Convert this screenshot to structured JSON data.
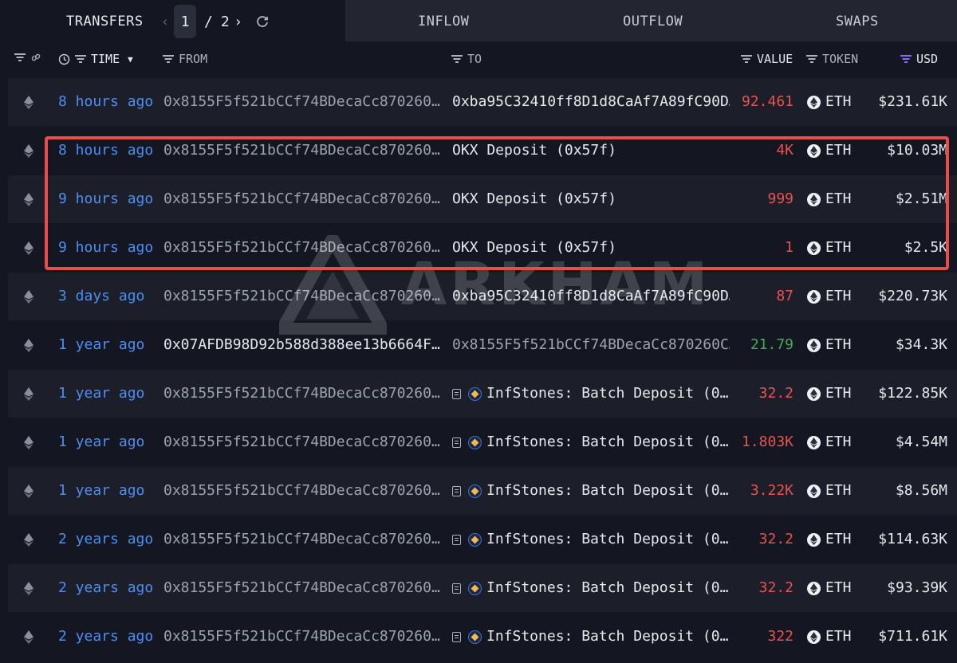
{
  "tabs": {
    "transfers": "TRANSFERS",
    "inflow": "INFLOW",
    "outflow": "OUTFLOW",
    "swaps": "SWAPS"
  },
  "pager": {
    "current": "1",
    "separator": "/",
    "total": "2"
  },
  "columns": {
    "time": "TIME",
    "from": "FROM",
    "to": "TO",
    "value": "VALUE",
    "token": "TOKEN",
    "usd": "USD"
  },
  "watermark": "ARKHAM",
  "colors": {
    "background": "#141721",
    "time_link": "#4d8ef0",
    "value_out": "#e8524f",
    "value_in": "#3fae5a",
    "highlight": "#ea4c4c",
    "usd_filter_active": "#8b6cff"
  },
  "rows": [
    {
      "time": "8 hours ago",
      "from": "0x8155F5f521bCCf74BDecaCc870260C…",
      "to": "0xba95C32410ff8D1d8CaAf7A89fC90D…",
      "value": "92.461",
      "token": "ETH",
      "usd": "$231.61K"
    },
    {
      "time": "8 hours ago",
      "from": "0x8155F5f521bCCf74BDecaCc870260C…",
      "to": "OKX Deposit (0x57f)",
      "value": "4K",
      "token": "ETH",
      "usd": "$10.03M"
    },
    {
      "time": "9 hours ago",
      "from": "0x8155F5f521bCCf74BDecaCc870260C…",
      "to": "OKX Deposit (0x57f)",
      "value": "999",
      "token": "ETH",
      "usd": "$2.51M"
    },
    {
      "time": "9 hours ago",
      "from": "0x8155F5f521bCCf74BDecaCc870260C…",
      "to": "OKX Deposit (0x57f)",
      "value": "1",
      "token": "ETH",
      "usd": "$2.5K"
    },
    {
      "time": "3 days ago",
      "from": "0x8155F5f521bCCf74BDecaCc870260C…",
      "to": "0xba95C32410ff8D1d8CaAf7A89fC90D…",
      "value": "87",
      "token": "ETH",
      "usd": "$220.73K"
    },
    {
      "time": "1 year ago",
      "from": "0x07AFDB98D92b588d388ee13b6664F1…",
      "to": "0x8155F5f521bCCf74BDecaCc870260C…",
      "value": "21.79",
      "token": "ETH",
      "usd": "$34.3K"
    },
    {
      "time": "1 year ago",
      "from": "0x8155F5f521bCCf74BDecaCc870260C…",
      "to": "InfStones: Batch Deposit (0…",
      "value": "32.2",
      "token": "ETH",
      "usd": "$122.85K"
    },
    {
      "time": "1 year ago",
      "from": "0x8155F5f521bCCf74BDecaCc870260C…",
      "to": "InfStones: Batch Deposit (0…",
      "value": "1.803K",
      "token": "ETH",
      "usd": "$4.54M"
    },
    {
      "time": "1 year ago",
      "from": "0x8155F5f521bCCf74BDecaCc870260C…",
      "to": "InfStones: Batch Deposit (0…",
      "value": "3.22K",
      "token": "ETH",
      "usd": "$8.56M"
    },
    {
      "time": "2 years ago",
      "from": "0x8155F5f521bCCf74BDecaCc870260C…",
      "to": "InfStones: Batch Deposit (0…",
      "value": "32.2",
      "token": "ETH",
      "usd": "$114.63K"
    },
    {
      "time": "2 years ago",
      "from": "0x8155F5f521bCCf74BDecaCc870260C…",
      "to": "InfStones: Batch Deposit (0…",
      "value": "32.2",
      "token": "ETH",
      "usd": "$93.39K"
    },
    {
      "time": "2 years ago",
      "from": "0x8155F5f521bCCf74BDecaCc870260C…",
      "to": "InfStones: Batch Deposit (0…",
      "value": "322",
      "token": "ETH",
      "usd": "$711.61K"
    }
  ]
}
